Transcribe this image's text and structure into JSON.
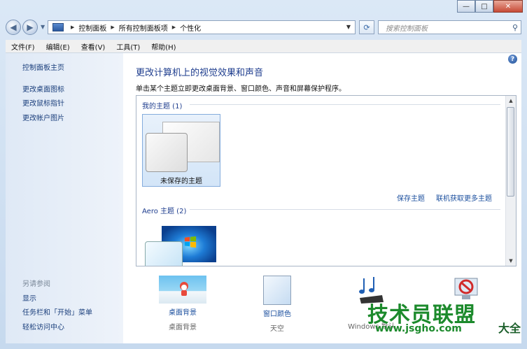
{
  "window": {
    "caption_buttons": {
      "minimize": "—",
      "maximize": "□",
      "close": "✕"
    }
  },
  "address": {
    "crumbs": [
      "控制面板",
      "所有控制面板项",
      "个性化"
    ],
    "search_placeholder": "搜索控制面板"
  },
  "menu": [
    "文件(F)",
    "编辑(E)",
    "查看(V)",
    "工具(T)",
    "帮助(H)"
  ],
  "sidebar": {
    "links": [
      "控制面板主页",
      "更改桌面图标",
      "更改鼠标指针",
      "更改帐户图片"
    ],
    "see_also_heading": "另请参阅",
    "see_also": [
      "显示",
      "任务栏和「开始」菜单",
      "轻松访问中心"
    ]
  },
  "main": {
    "title": "更改计算机上的视觉效果和声音",
    "subtitle": "单击某个主题立即更改桌面背景、窗口颜色、声音和屏幕保护程序。",
    "my_themes_label": "我的主题 (1)",
    "unsaved_theme": "未保存的主题",
    "save_theme": "保存主题",
    "get_more_online": "联机获取更多主题",
    "aero_label": "Aero 主题 (2)"
  },
  "bottom": {
    "desktop_bg": {
      "caption": "桌面背景",
      "value": "桌面背景"
    },
    "window_color": {
      "caption": "窗口颜色",
      "value": "天空"
    },
    "sounds": {
      "value": "Windows 默认"
    }
  },
  "watermark": {
    "main": "技术员联盟",
    "url": "www.jsgho.com",
    "tail": "大全"
  },
  "colors": {
    "accent": "#1e3d8e",
    "link": "#1b4f9e"
  }
}
